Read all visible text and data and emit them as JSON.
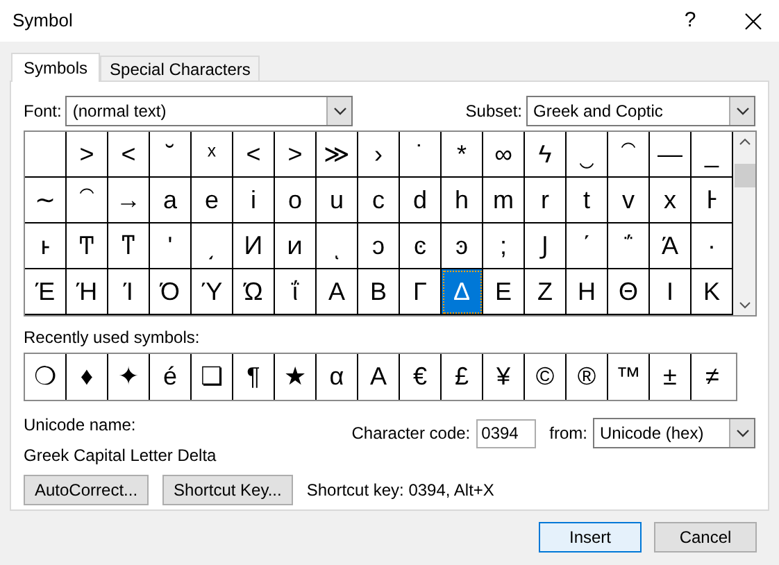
{
  "window": {
    "title": "Symbol",
    "help": "?"
  },
  "tabs": [
    {
      "label": "Symbols",
      "selected": true
    },
    {
      "label": "Special Characters",
      "selected": false
    }
  ],
  "font": {
    "label": "Font:",
    "value": "(normal text)"
  },
  "subset": {
    "label": "Subset:",
    "value": "Greek and Coptic"
  },
  "grid": [
    [
      {
        "selected": false
      },
      {
        "char": "˃",
        "selected": false
      },
      {
        "char": "˂",
        "selected": false
      },
      {
        "char": "˘",
        "selected": false
      },
      {
        "char": "ˣ",
        "selected": false
      },
      {
        "char": "˂",
        "selected": false
      },
      {
        "char": "˃",
        "selected": false
      },
      {
        "char": "≫",
        "selected": false
      },
      {
        "char": "›",
        "selected": false
      },
      {
        "char": "˙",
        "selected": false
      },
      {
        "char": "*",
        "selected": false
      },
      {
        "char": "∞",
        "selected": false
      },
      {
        "char": "ϟ",
        "selected": false
      },
      {
        "char": "‿",
        "selected": false
      },
      {
        "char": "⁀",
        "selected": false
      },
      {
        "char": "—",
        "selected": false
      },
      {
        "char": "_",
        "selected": false
      }
    ],
    [
      {
        "char": "∼",
        "selected": false
      },
      {
        "char": "⁀",
        "selected": false
      },
      {
        "char": "→",
        "selected": false
      },
      {
        "char": "a",
        "selected": false
      },
      {
        "char": "e",
        "selected": false
      },
      {
        "char": "i",
        "selected": false
      },
      {
        "char": "o",
        "selected": false
      },
      {
        "char": "u",
        "selected": false
      },
      {
        "char": "c",
        "selected": false
      },
      {
        "char": "d",
        "selected": false
      },
      {
        "char": "h",
        "selected": false
      },
      {
        "char": "m",
        "selected": false
      },
      {
        "char": "r",
        "selected": false
      },
      {
        "char": "t",
        "selected": false
      },
      {
        "char": "v",
        "selected": false
      },
      {
        "char": "x",
        "selected": false
      },
      {
        "char": "Ͱ",
        "selected": false
      }
    ],
    [
      {
        "char": "ͱ",
        "selected": false
      },
      {
        "char": "Ͳ",
        "selected": false
      },
      {
        "char": "ͳ",
        "selected": false
      },
      {
        "char": "ʹ",
        "selected": false
      },
      {
        "char": "͵",
        "selected": false
      },
      {
        "char": "Ͷ",
        "selected": false
      },
      {
        "char": "ͷ",
        "selected": false
      },
      {
        "char": "ͺ",
        "selected": false
      },
      {
        "char": "ͻ",
        "selected": false
      },
      {
        "char": "ͼ",
        "selected": false
      },
      {
        "char": "ͽ",
        "selected": false
      },
      {
        "char": ";",
        "selected": false
      },
      {
        "char": "Ϳ",
        "selected": false
      },
      {
        "char": "΄",
        "selected": false
      },
      {
        "char": "΅",
        "selected": false
      },
      {
        "char": "Ά",
        "selected": false
      },
      {
        "char": "·",
        "selected": false
      }
    ],
    [
      {
        "char": "Έ",
        "selected": false
      },
      {
        "char": "Ή",
        "selected": false
      },
      {
        "char": "Ί",
        "selected": false
      },
      {
        "char": "Ό",
        "selected": false
      },
      {
        "char": "Ύ",
        "selected": false
      },
      {
        "char": "Ώ",
        "selected": false
      },
      {
        "char": "ΐ",
        "selected": false
      },
      {
        "char": "Α",
        "selected": false
      },
      {
        "char": "Β",
        "selected": false
      },
      {
        "char": "Γ",
        "selected": false
      },
      {
        "char": "Δ",
        "selected": true
      },
      {
        "char": "Ε",
        "selected": false
      },
      {
        "char": "Ζ",
        "selected": false
      },
      {
        "char": "Η",
        "selected": false
      },
      {
        "char": "Θ",
        "selected": false
      },
      {
        "char": "Ι",
        "selected": false
      },
      {
        "char": "Κ",
        "selected": false
      }
    ]
  ],
  "recent": {
    "label": "Recently used symbols:",
    "symbols": [
      "❍",
      "♦",
      "✦",
      "é",
      "❏",
      "¶",
      "★",
      "α",
      "A",
      "€",
      "£",
      "¥",
      "©",
      "®",
      "™",
      "±",
      "≠"
    ]
  },
  "unicode_name": {
    "label": "Unicode name:",
    "value": "Greek Capital Letter Delta"
  },
  "character_code": {
    "label": "Character code:",
    "value": "0394"
  },
  "from": {
    "label": "from:",
    "value": "Unicode (hex)"
  },
  "buttons": [
    "AutoCorrect...",
    "Shortcut Key..."
  ],
  "shortcut_text": "Shortcut key: 0394, Alt+X",
  "footer": [
    {
      "label": "Insert",
      "default": true
    },
    {
      "label": "Cancel",
      "default": false
    }
  ]
}
